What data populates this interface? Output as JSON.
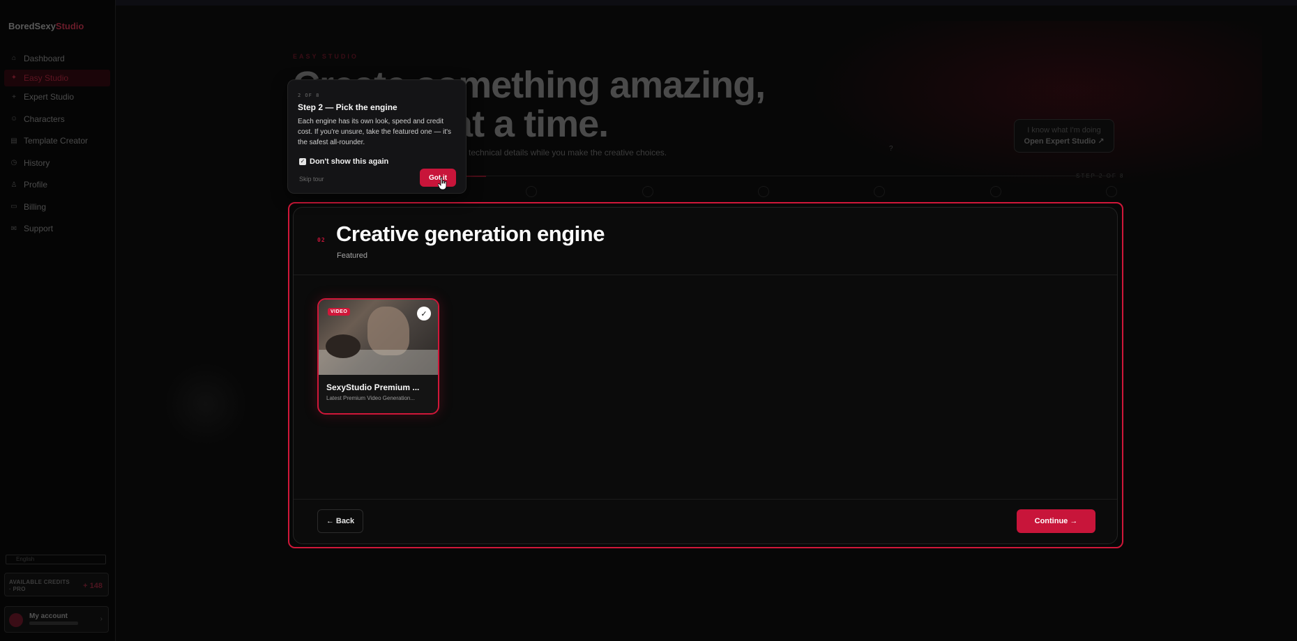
{
  "app": {
    "brand_primary": "BoredSexy",
    "brand_accent": "Studio",
    "accent_color": "#c8153a"
  },
  "sidebar": {
    "items": [
      {
        "label": "Dashboard",
        "icon": "home-icon"
      },
      {
        "label": "Easy Studio",
        "icon": "sparkle-icon",
        "active": true
      },
      {
        "label": "Expert Studio",
        "icon": "plus-icon"
      },
      {
        "label": "Characters",
        "icon": "users-icon"
      },
      {
        "label": "Template Creator",
        "icon": "template-icon"
      },
      {
        "label": "History",
        "icon": "history-icon"
      },
      {
        "label": "Profile",
        "icon": "user-icon"
      },
      {
        "label": "Billing",
        "icon": "card-icon"
      },
      {
        "label": "Support",
        "icon": "support-icon"
      }
    ],
    "language": "English",
    "credits_label": "AVAILABLE CREDITS",
    "credits_plan": "· PRO",
    "credits_value": "+ 148",
    "account_label": "My account"
  },
  "hero": {
    "eyebrow": "EASY STUDIO",
    "title_line1": "Create something amazing,",
    "title_line2": "one step at a time.",
    "subtitle": "technical details while you make the creative choices.",
    "expert_hint": "I know what I'm doing",
    "expert_link": "Open Expert Studio ↗",
    "help": "?",
    "step_counter": "STEP 2 OF 8"
  },
  "tour": {
    "counter": "2 OF 8",
    "title": "Step 2 — Pick the engine",
    "body": "Each engine has its own look, speed and credit cost. If you're unsure, take the featured one — it's the safest all-rounder.",
    "checkbox_label": "Don't show this again",
    "checkbox_checked": true,
    "skip_label": "Skip tour",
    "confirm_label": "Got it"
  },
  "panel": {
    "step_number": "02",
    "title": "Creative generation engine",
    "subtitle": "Featured",
    "engines": [
      {
        "badge": "VIDEO",
        "name": "SexyStudio Premium ...",
        "description": "Latest Premium Video Generation...",
        "selected": true
      }
    ],
    "back_label": "← Back",
    "continue_label": "Continue →"
  }
}
